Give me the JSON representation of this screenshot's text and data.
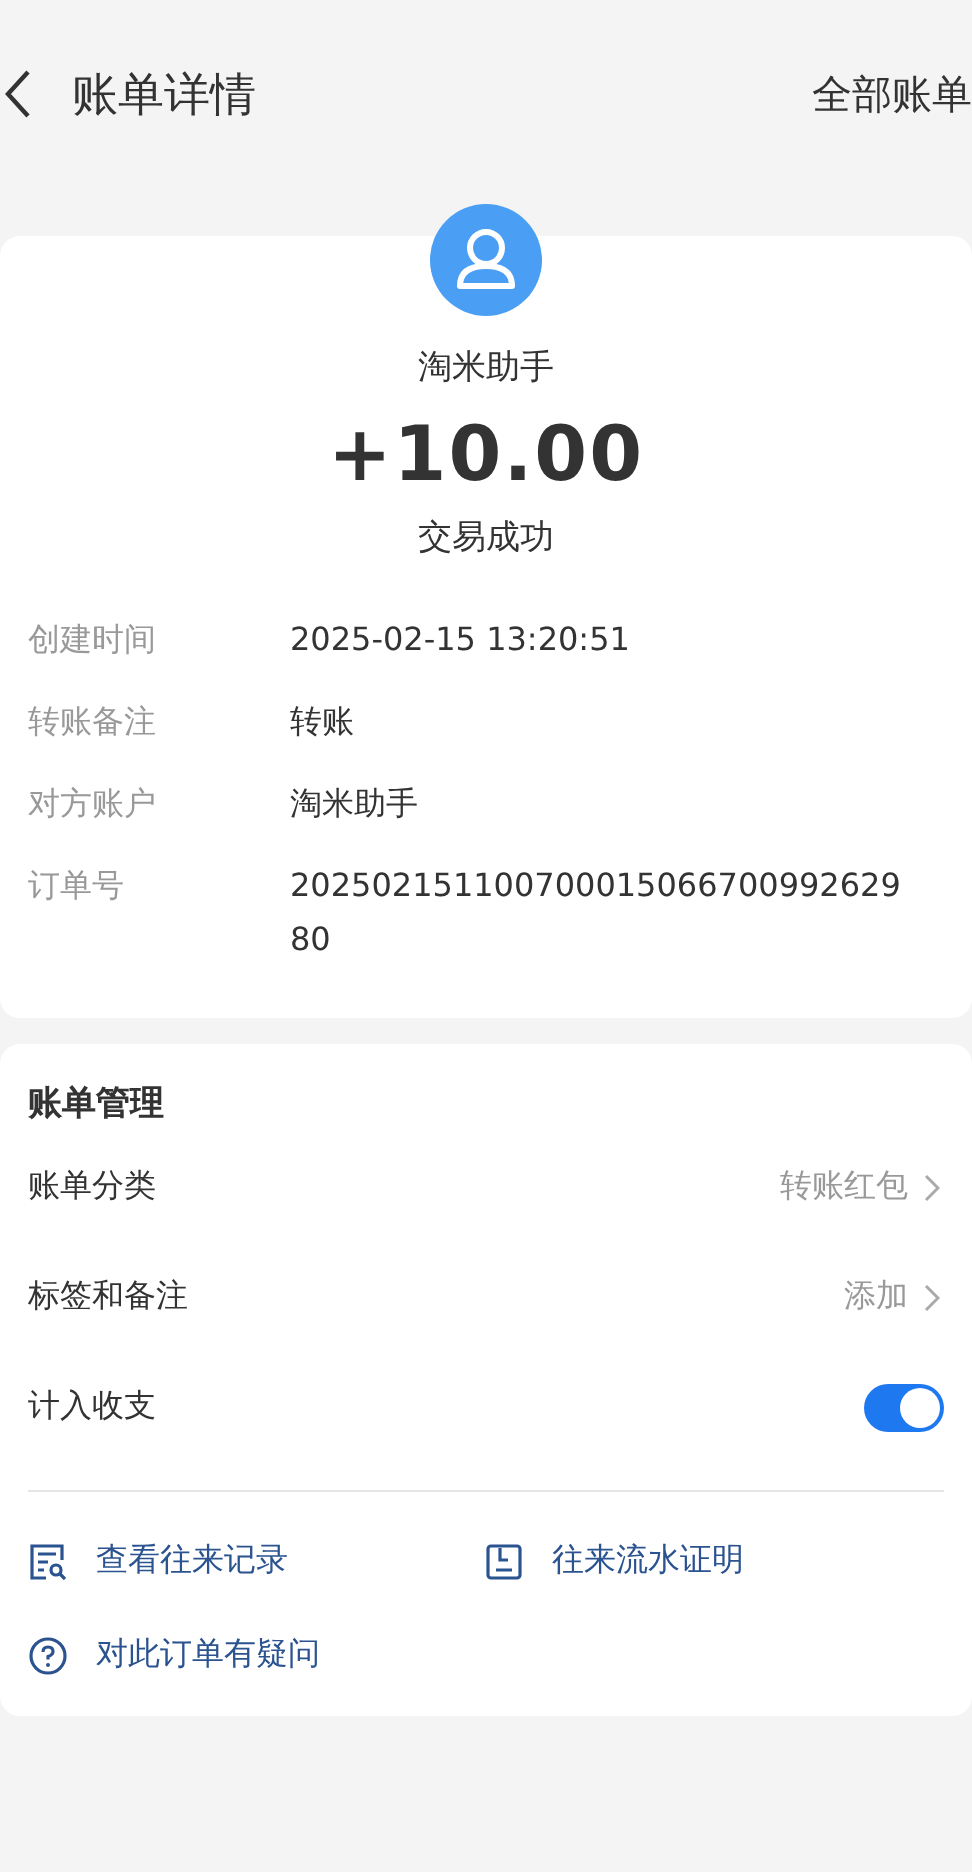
{
  "header": {
    "title": "账单详情",
    "action": "全部账单"
  },
  "summary": {
    "payee": "淘米助手",
    "amount": "+10.00",
    "status": "交易成功"
  },
  "details": [
    {
      "label": "创建时间",
      "value": "2025-02-15 13:20:51"
    },
    {
      "label": "转账备注",
      "value": "转账"
    },
    {
      "label": "对方账户",
      "value": "淘米助手"
    },
    {
      "label": "订单号",
      "value": "20250215110070001506670099262980"
    }
  ],
  "management": {
    "title": "账单管理",
    "rows": [
      {
        "kind": "link",
        "label": "账单分类",
        "value": "转账红包"
      },
      {
        "kind": "link",
        "label": "标签和备注",
        "value": "添加"
      },
      {
        "kind": "toggle",
        "label": "计入收支",
        "on": true
      }
    ],
    "links": [
      {
        "kind": "records",
        "label": "查看往来记录"
      },
      {
        "kind": "proof",
        "label": "往来流水证明"
      },
      {
        "kind": "question",
        "label": "对此订单有疑问"
      }
    ]
  }
}
